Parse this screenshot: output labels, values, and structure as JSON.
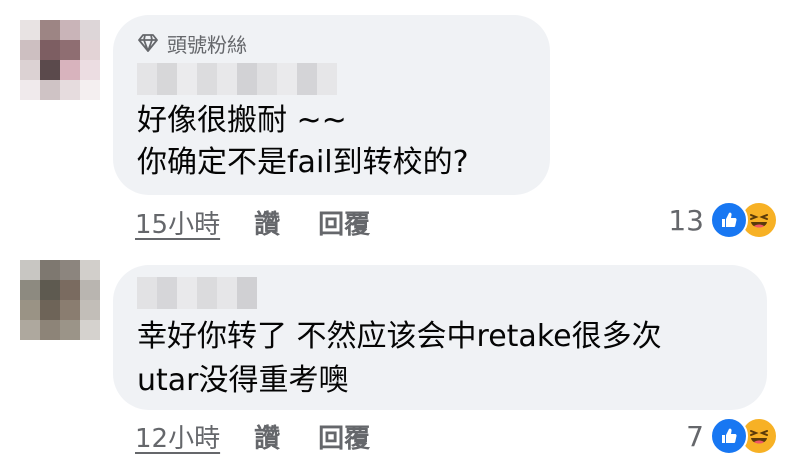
{
  "comments": [
    {
      "badge": {
        "icon": "diamond-icon",
        "label": "頭號粉絲"
      },
      "text_lines": [
        "好像很搬耐 ~~",
        "你确定不是fail到转校的?"
      ],
      "time": "15小時",
      "like_label": "讚",
      "reply_label": "回覆",
      "reaction_count": "13",
      "reactions": [
        "like-reaction-icon",
        "haha-reaction-icon"
      ]
    },
    {
      "text_lines": [
        "幸好你转了 不然应该会中retake很多次",
        "utar没得重考噢"
      ],
      "time": "12小時",
      "like_label": "讚",
      "reply_label": "回覆",
      "reaction_count": "7",
      "reactions": [
        "like-reaction-icon",
        "haha-reaction-icon"
      ]
    }
  ],
  "colors": {
    "bubble": "#f0f2f5",
    "secondary_text": "#65676b",
    "like_blue": "#1877f2",
    "haha_yellow": "#f7b125"
  }
}
